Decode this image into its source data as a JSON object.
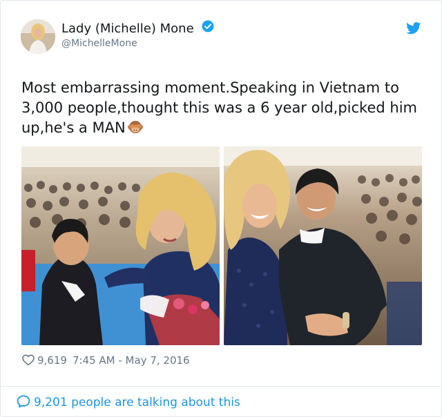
{
  "author": {
    "name": "Lady (Michelle) Mone",
    "handle": "@MichelleMone",
    "verified": true
  },
  "tweet": {
    "text": "Most embarrassing moment.Speaking in Vietnam to 3,000 people,thought this was a 6 year old,picked him up,he's a MAN",
    "emoji": "see-no-evil-monkey"
  },
  "media": [
    {
      "icon": "photo-stage-handshake"
    },
    {
      "icon": "photo-selfie-holding-man"
    }
  ],
  "meta": {
    "likes": "9,619",
    "timestamp": "7:45 AM - May 7, 2016"
  },
  "footer": {
    "talking": "9,201 people are talking about this"
  },
  "colors": {
    "brand": "#1da1f2",
    "link": "#1b95e0",
    "muted": "#657786"
  }
}
